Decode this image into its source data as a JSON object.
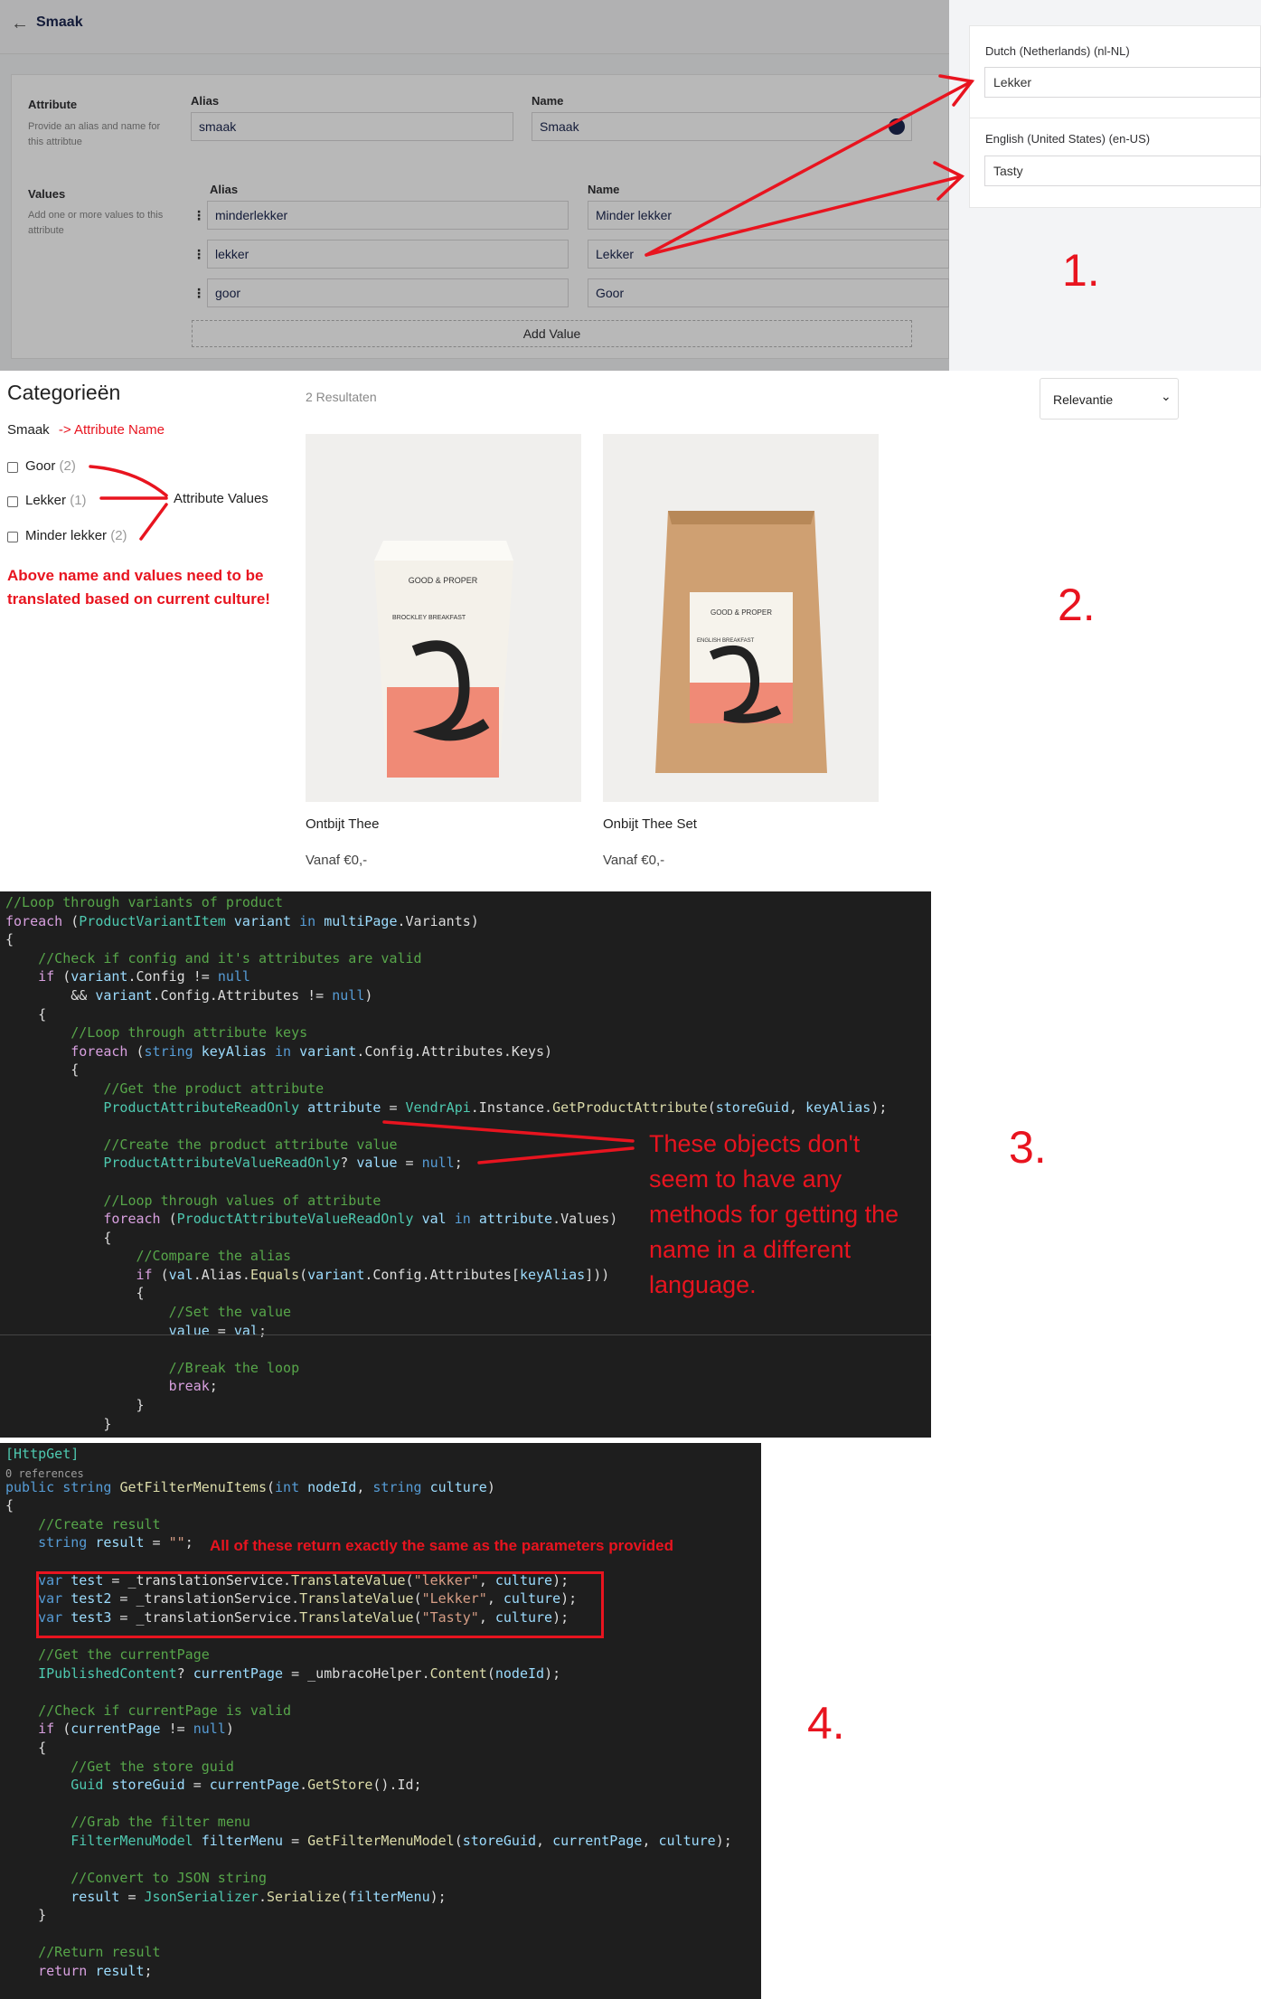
{
  "backoffice": {
    "title": "Smaak",
    "attribute": {
      "label": "Attribute",
      "help": "Provide an alias and name for this attribtue"
    },
    "alias_header": "Alias",
    "name_header": "Name",
    "alias_value": "smaak",
    "name_value": "Smaak",
    "values": {
      "label": "Values",
      "help": "Add one or more values to this attribute"
    },
    "rows": [
      {
        "alias": "minderlekker",
        "name": "Minder lekker"
      },
      {
        "alias": "lekker",
        "name": "Lekker"
      },
      {
        "alias": "goor",
        "name": "Goor"
      }
    ],
    "add_value": "Add Value"
  },
  "language_panel": {
    "langs": [
      {
        "label": "Dutch (Netherlands) (nl-NL)",
        "value": "Lekker"
      },
      {
        "label": "English (United States) (en-US)",
        "value": "Tasty"
      }
    ]
  },
  "numbers": [
    "1.",
    "2.",
    "3.",
    "4."
  ],
  "shop": {
    "categories_title": "Categorieën",
    "attribute_name": "Smaak",
    "attribute_name_annot": "-> Attribute Name",
    "filters": [
      {
        "label": "Goor",
        "count": "(2)"
      },
      {
        "label": "Lekker",
        "count": "(1)"
      },
      {
        "label": "Minder lekker",
        "count": "(2)"
      }
    ],
    "attribute_values_annot": "Attribute Values",
    "note": "Above name and values need to be translated based on current culture!",
    "results": "2 Resultaten",
    "sort": "Relevantie",
    "products": [
      {
        "name": "Ontbijt Thee",
        "price": "Vanaf €0,-",
        "brand": "GOOD & PROPER",
        "sub": "BROCKLEY BREAKFAST"
      },
      {
        "name": "Onbijt Thee Set",
        "price": "Vanaf €0,-",
        "brand": "GOOD & PROPER",
        "sub": "ENGLISH BREAKFAST"
      }
    ]
  },
  "code3_annot": "These objects don't seem to have any methods for getting the name in a different language.",
  "code4_annot": "All of these return exactly the same as the parameters provided",
  "code4_refs": "0 references"
}
